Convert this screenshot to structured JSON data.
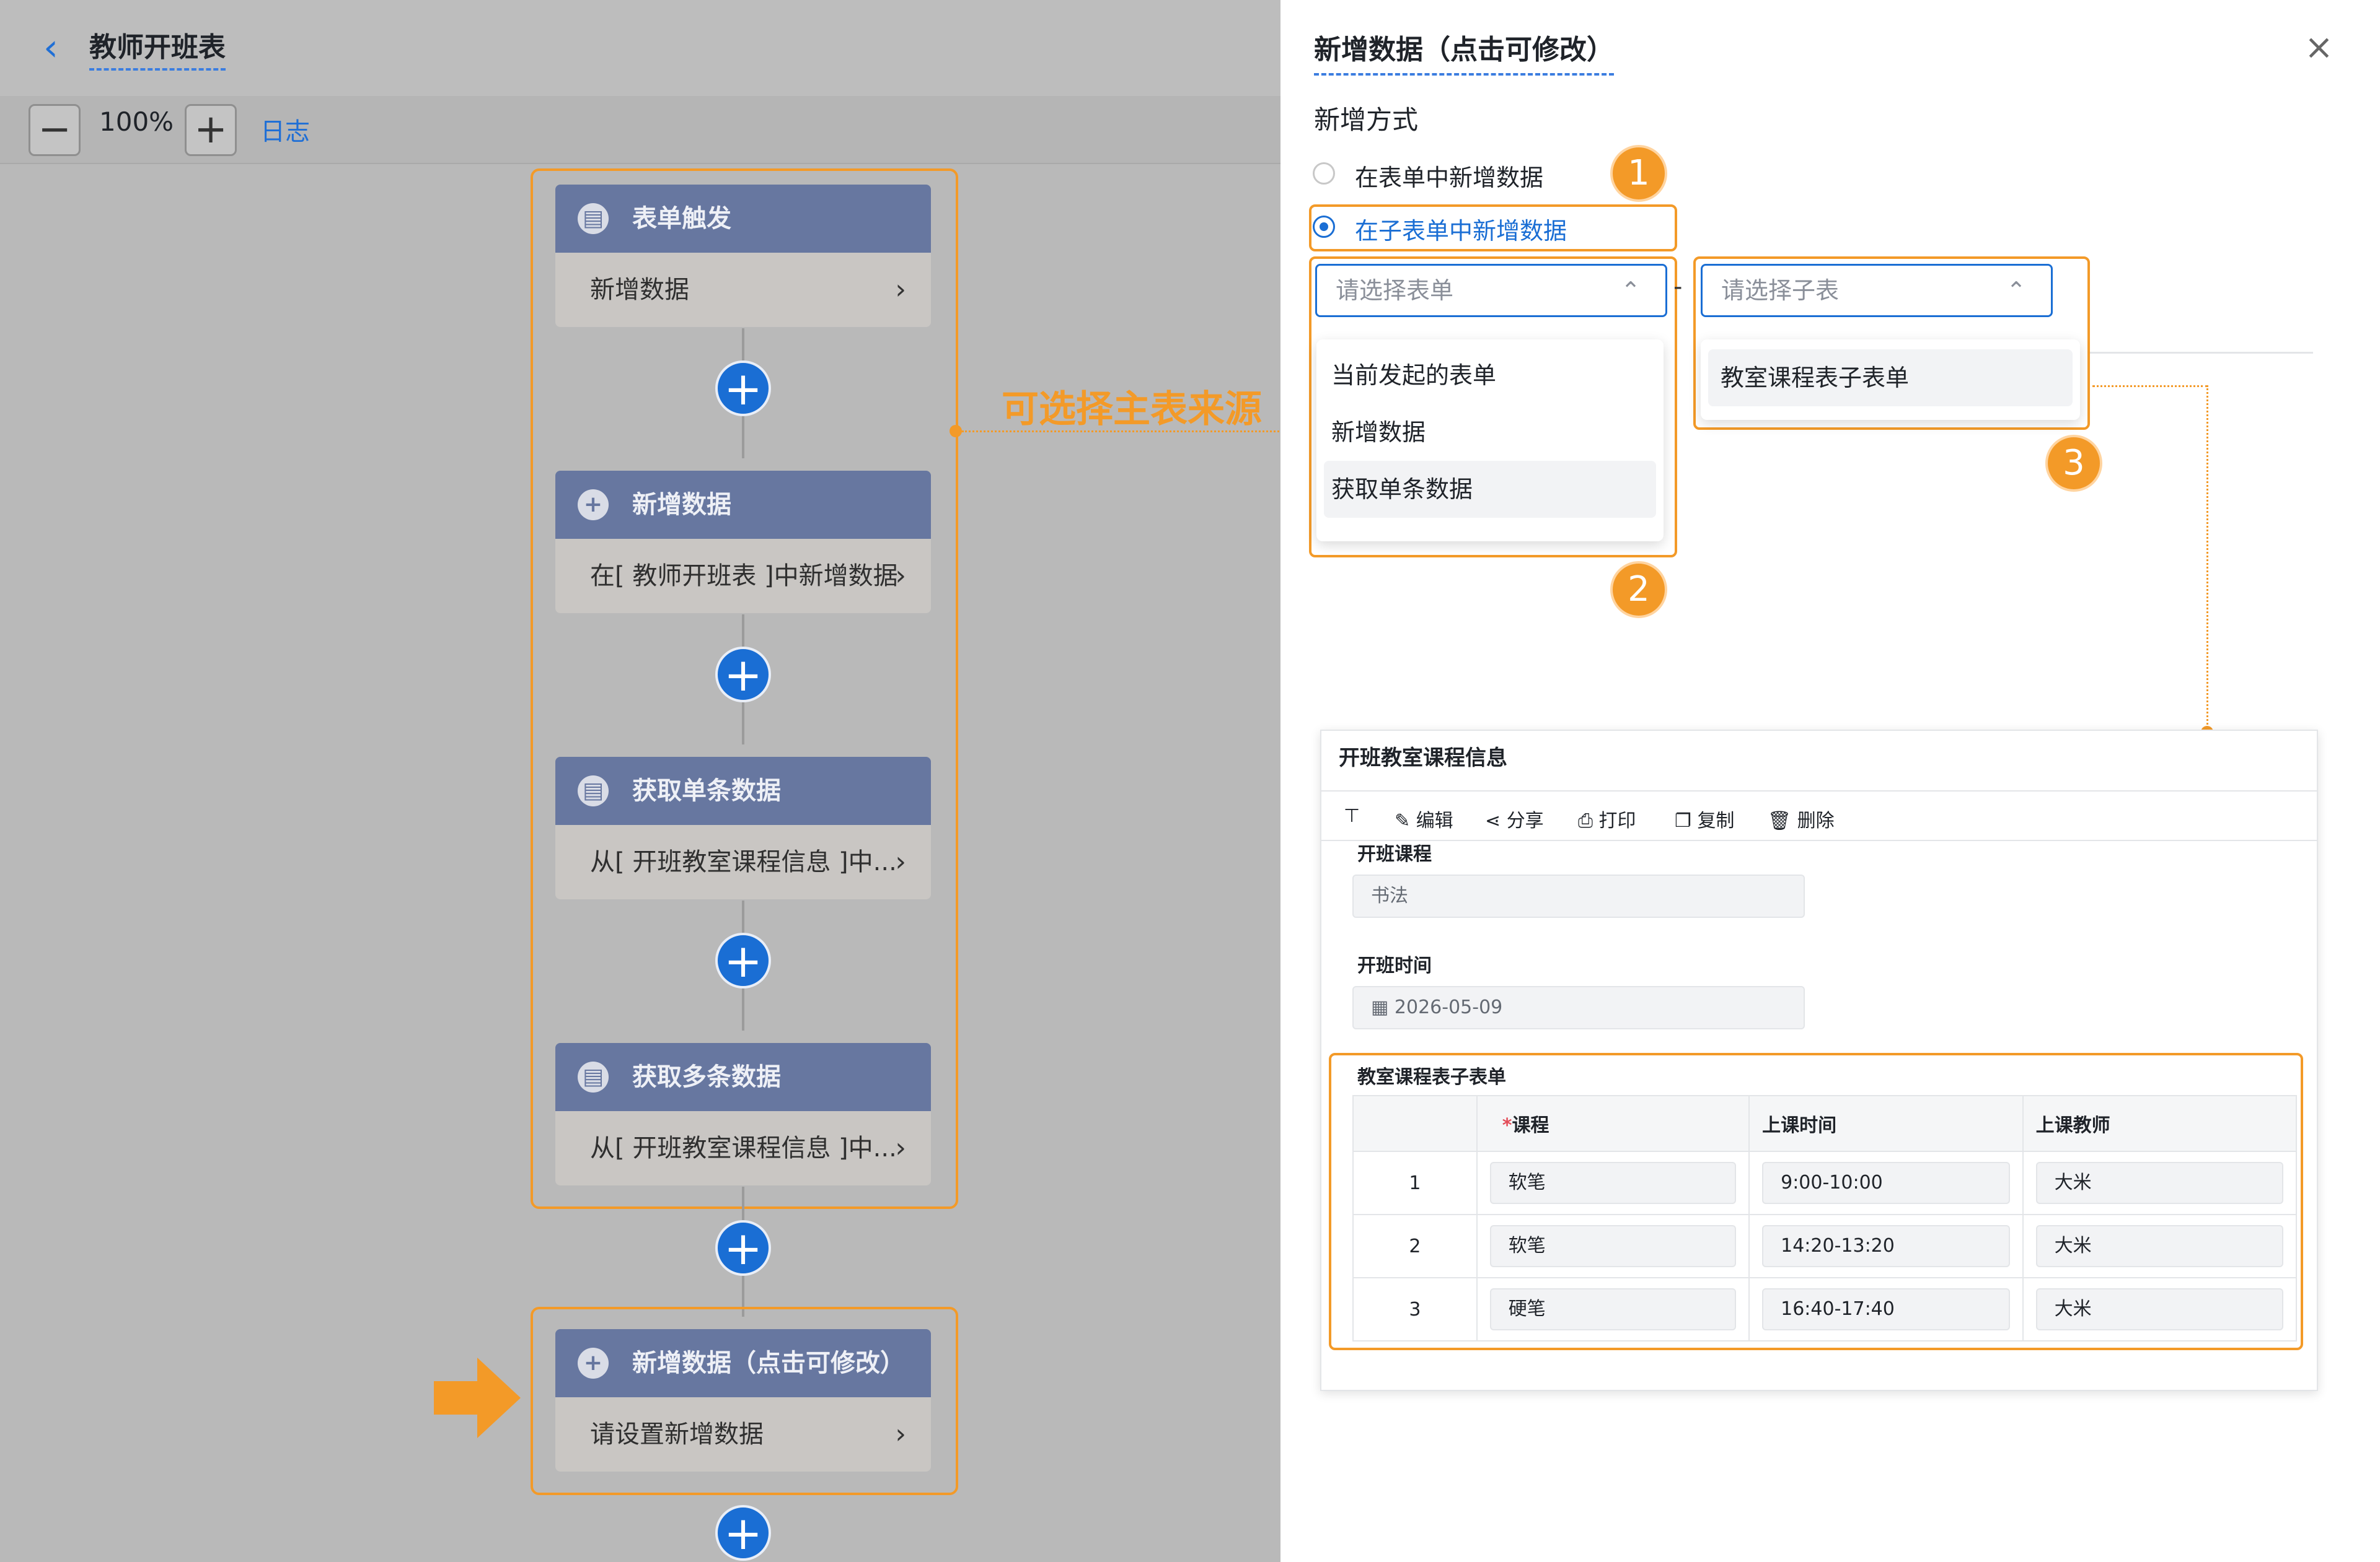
{
  "header": {
    "title": "教师开班表",
    "zoom": "100%",
    "log_label": "日志"
  },
  "annotation_label": "可选择主表来源",
  "nodes": [
    {
      "title": "表单触发",
      "body": "新增数据",
      "icon": "form-icon"
    },
    {
      "title": "新增数据",
      "body": "在[ 教师开班表 ]中新增数据",
      "icon": "plus-circle-icon"
    },
    {
      "title": "获取单条数据",
      "body": "从[ 开班教室课程信息 ]中...",
      "icon": "form-icon"
    },
    {
      "title": "获取多条数据",
      "body": "从[ 开班教室课程信息 ]中...",
      "icon": "form-icon"
    },
    {
      "title": "新增数据（点击可修改）",
      "body": "请设置新增数据",
      "icon": "plus-circle-icon"
    }
  ],
  "panel": {
    "title": "新增数据（点击可修改）",
    "section_label": "新增方式",
    "radio_options": [
      "在表单中新增数据",
      "在子表单中新增数据"
    ],
    "selected_radio": 1,
    "form_select_placeholder": "请选择表单",
    "subform_select_placeholder": "请选择子表",
    "separator": "-",
    "form_options": [
      "当前发起的表单",
      "新增数据",
      "获取单条数据"
    ],
    "subform_options": [
      "教室课程表子表单"
    ],
    "badges": [
      "1",
      "2",
      "3"
    ]
  },
  "preview": {
    "title": "开班教室课程信息",
    "toolbar": [
      "编辑",
      "分享",
      "打印",
      "复制",
      "删除"
    ],
    "fields": [
      {
        "label": "开班课程",
        "value": "书法"
      },
      {
        "label": "开班时间",
        "value": "2026-05-09"
      }
    ],
    "subform_title": "教室课程表子表单",
    "columns": [
      "",
      "*课程",
      "上课时间",
      "上课教师"
    ],
    "rows": [
      {
        "index": "1",
        "course": "软笔",
        "time": "9:00-10:00",
        "teacher": "大米"
      },
      {
        "index": "2",
        "course": "软笔",
        "time": "14:20-13:20",
        "teacher": "大米"
      },
      {
        "index": "3",
        "course": "硬笔",
        "time": "16:40-17:40",
        "teacher": "大米"
      }
    ]
  },
  "colors": {
    "accent": "#1a6ed4",
    "highlight": "#f39a28",
    "node_header": "#6777a0"
  }
}
